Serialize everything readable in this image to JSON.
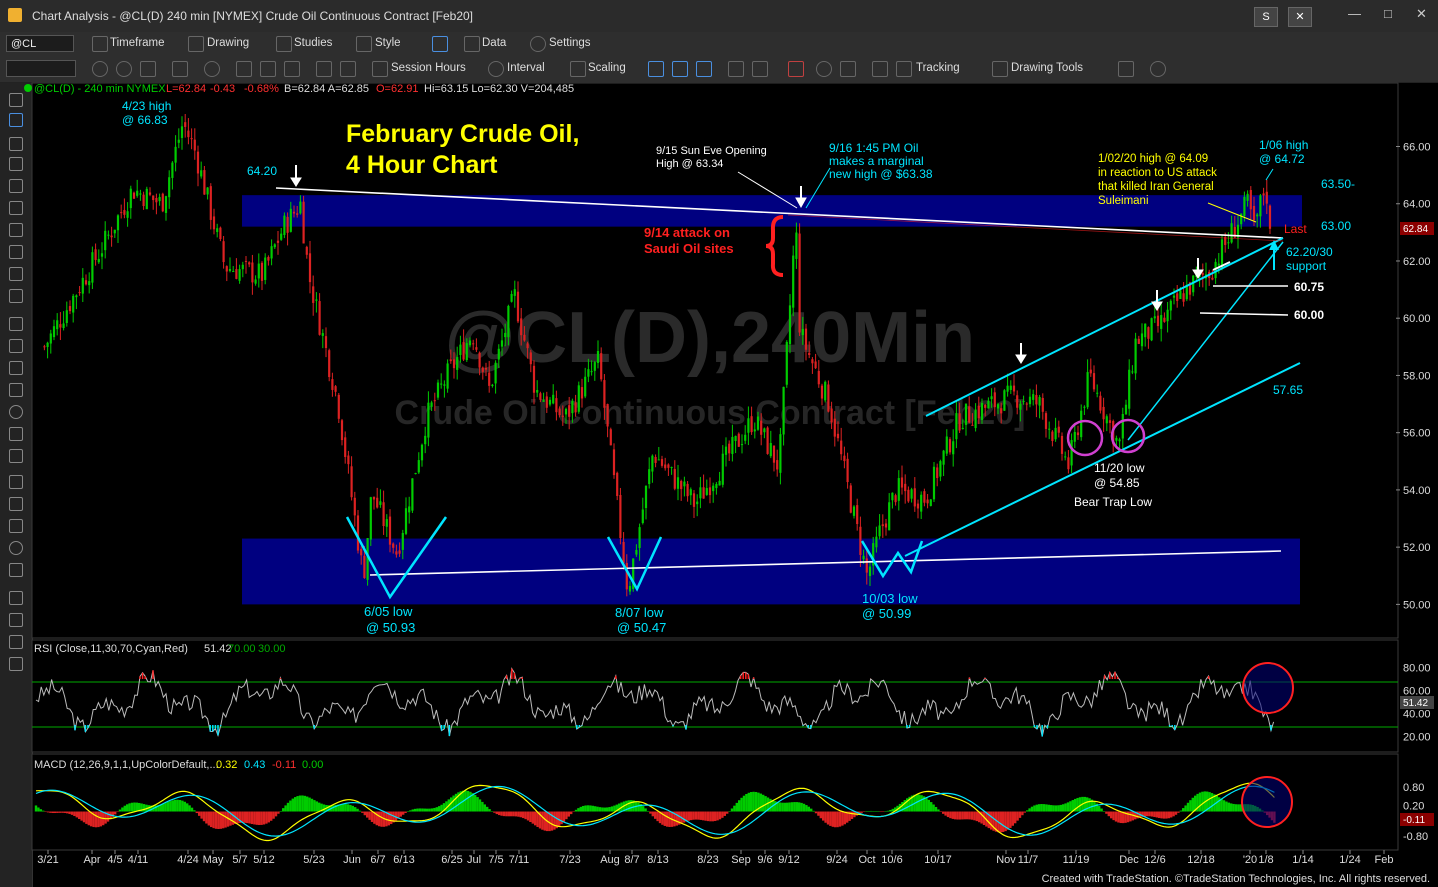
{
  "window": {
    "title": "Chart Analysis - @CL(D) 240 min [NYMEX] Crude Oil Continuous Contract [Feb20]",
    "btn_s": "S",
    "btn_tools": "✕"
  },
  "toolbar1": {
    "symbol": "@CL",
    "items": [
      "Timeframe",
      "Drawing",
      "Studies",
      "Style",
      "Data",
      "Settings"
    ]
  },
  "toolbar2": {
    "items": [
      "Session Hours",
      "Interval",
      "Scaling",
      "Tracking",
      "Drawing Tools"
    ]
  },
  "price_header": {
    "symbol": "@CL(D) - 240 min  NYMEX",
    "last": "L=62.84",
    "change": "-0.43",
    "pct": "-0.68%",
    "rest": "B=62.84  A=62.85",
    "open": "O=62.91",
    "tail": "Hi=63.15  Lo=62.30  V=204,485"
  },
  "watermark": {
    "big": "@CL(D),240Min",
    "sub": "Crude Oil Continuous Contract [Feb20]"
  },
  "colors": {
    "zone": "#000080",
    "up": "#00cc00",
    "down": "#dd2222",
    "cyan": "#00e5ff",
    "yellow": "#ffff00",
    "red_text": "#ff2020",
    "magenta": "#d040d0"
  },
  "annotations": {
    "title1": "February Crude Oil,",
    "title2": "4 Hour Chart",
    "high_423_a": "4/23 high",
    "high_423_b": "@ 66.83",
    "l6420": "64.20",
    "sunEve_a": "9/15 Sun Eve Opening",
    "sunEve_b": "High @ 63.34",
    "oil916_a": "9/16 1:45 PM Oil",
    "oil916_b": "makes a marginal",
    "oil916_c": "new high @ $63.38",
    "attack_a": "9/14 attack on",
    "attack_b": "Saudi Oil sites",
    "h0102_a": "1/02/20 high @ 64.09",
    "h0102_b": "in reaction to US attack",
    "h0102_c": "that killed Iran General",
    "h0102_d": "Suleimani",
    "h0106_a": "1/06 high",
    "h0106_b": "@ 64.72",
    "r6350": "63.50-",
    "r6300": "63.00",
    "last": "Last",
    "sup_a": "62.20/30",
    "sup_b": "support",
    "l6075": "60.75",
    "l6000": "60.00",
    "l5765": "57.65",
    "low1120_a": "11/20 low",
    "low1120_b": "@ 54.85",
    "beartrap": "Bear Trap Low",
    "low605_a": "6/05 low",
    "low605_b": "@ 50.93",
    "low807_a": "8/07 low",
    "low807_b": "@ 50.47",
    "low1003_a": "10/03 low",
    "low1003_b": "@ 50.99"
  },
  "rsi_header": {
    "label": "RSI (Close,11,30,70,Cyan,Red)",
    "value": "51.42",
    "ob": "70.00",
    "os": "30.00"
  },
  "macd_header": {
    "label": "MACD (12,26,9,1,1,UpColorDefault,...",
    "v1": "0.32",
    "v2": "0.43",
    "v3": "-0.11",
    "v4": "0.00"
  },
  "current_price_label": "62.84",
  "rsi_value_label": "51.42",
  "macd_value_label": "-0.11",
  "footer": "Created with TradeStation. ©TradeStation Technologies, Inc. All rights reserved.",
  "chart_data": [
    {
      "type": "candlestick",
      "title": "",
      "y_axis_ticks": [
        66,
        64,
        62,
        60,
        58,
        56,
        54,
        52,
        50
      ],
      "ylim": [
        49.0,
        67.8
      ],
      "x_tick_labels": [
        "3/21",
        "Apr",
        "4/5",
        "4/11",
        "4/24",
        "May",
        "5/7",
        "5/12",
        "5/23",
        "Jun",
        "6/7",
        "6/13",
        "6/25",
        "Jul",
        "7/5",
        "7/11",
        "7/23",
        "Aug",
        "8/7",
        "8/13",
        "8/23",
        "Sep",
        "9/6",
        "9/12",
        "9/24",
        "Oct",
        "10/6",
        "10/17",
        "Nov",
        "11/7",
        "11/19",
        "Dec",
        "12/6",
        "12/18",
        "'20",
        "1/8",
        "1/14",
        "1/24",
        "Feb"
      ],
      "price_path": [
        {
          "date": "2019-03-21",
          "price": 59.0
        },
        {
          "date": "2019-04-05",
          "price": 62.8
        },
        {
          "date": "2019-04-11",
          "price": 64.5
        },
        {
          "date": "2019-04-18",
          "price": 64.0
        },
        {
          "date": "2019-04-23",
          "price": 66.83
        },
        {
          "date": "2019-04-26",
          "price": 65.8
        },
        {
          "date": "2019-05-03",
          "price": 61.8
        },
        {
          "date": "2019-05-12",
          "price": 61.5
        },
        {
          "date": "2019-05-17",
          "price": 63.2
        },
        {
          "date": "2019-05-21",
          "price": 64.0
        },
        {
          "date": "2019-05-23",
          "price": 61.5
        },
        {
          "date": "2019-05-30",
          "price": 57.0
        },
        {
          "date": "2019-06-05",
          "price": 50.93
        },
        {
          "date": "2019-06-07",
          "price": 53.9
        },
        {
          "date": "2019-06-13",
          "price": 51.8
        },
        {
          "date": "2019-06-20",
          "price": 56.5
        },
        {
          "date": "2019-06-25",
          "price": 58.0
        },
        {
          "date": "2019-07-01",
          "price": 59.5
        },
        {
          "date": "2019-07-05",
          "price": 57.5
        },
        {
          "date": "2019-07-11",
          "price": 60.8
        },
        {
          "date": "2019-07-16",
          "price": 57.5
        },
        {
          "date": "2019-07-23",
          "price": 56.5
        },
        {
          "date": "2019-07-31",
          "price": 58.5
        },
        {
          "date": "2019-08-07",
          "price": 50.47
        },
        {
          "date": "2019-08-13",
          "price": 55.3
        },
        {
          "date": "2019-08-23",
          "price": 53.5
        },
        {
          "date": "2019-08-30",
          "price": 55.0
        },
        {
          "date": "2019-09-06",
          "price": 56.5
        },
        {
          "date": "2019-09-12",
          "price": 54.8
        },
        {
          "date": "2019-09-16",
          "price": 63.38
        },
        {
          "date": "2019-09-17",
          "price": 59.5
        },
        {
          "date": "2019-09-24",
          "price": 57.0
        },
        {
          "date": "2019-10-03",
          "price": 50.99
        },
        {
          "date": "2019-10-06",
          "price": 52.5
        },
        {
          "date": "2019-10-10",
          "price": 54.0
        },
        {
          "date": "2019-10-17",
          "price": 53.7
        },
        {
          "date": "2019-10-25",
          "price": 56.5
        },
        {
          "date": "2019-11-07",
          "price": 57.3
        },
        {
          "date": "2019-11-13",
          "price": 57.0
        },
        {
          "date": "2019-11-20",
          "price": 54.85
        },
        {
          "date": "2019-11-25",
          "price": 58.0
        },
        {
          "date": "2019-12-02",
          "price": 55.5
        },
        {
          "date": "2019-12-06",
          "price": 59.2
        },
        {
          "date": "2019-12-12",
          "price": 59.8
        },
        {
          "date": "2019-12-18",
          "price": 61.0
        },
        {
          "date": "2019-12-24",
          "price": 61.7
        },
        {
          "date": "2020-01-02",
          "price": 64.09
        },
        {
          "date": "2020-01-03",
          "price": 63.0
        },
        {
          "date": "2020-01-06",
          "price": 64.72
        },
        {
          "date": "2020-01-07",
          "price": 62.84
        }
      ],
      "price_zones": [
        [
          63.2,
          64.3
        ],
        [
          50.0,
          52.3
        ]
      ],
      "horizontal_levels": [
        60.75,
        60.0
      ]
    },
    {
      "type": "line",
      "title": "RSI (Close,11,30,70,Cyan,Red)",
      "y_axis_ticks": [
        80,
        60,
        40,
        20
      ],
      "ylim": [
        10,
        90
      ],
      "series": [
        {
          "name": "RSI",
          "last": 51.42
        }
      ],
      "reference_lines": [
        70,
        30
      ]
    },
    {
      "type": "line",
      "title": "MACD (12,26,9,1,1,UpColorDefault,...",
      "y_axis_ticks": [
        0.8,
        0.2,
        -0.2,
        -0.8
      ],
      "ylim": [
        -1.2,
        1.3
      ],
      "series": [
        {
          "name": "MACD",
          "last": 0.32
        },
        {
          "name": "Signal",
          "last": 0.43
        },
        {
          "name": "Histogram",
          "last": -0.11
        }
      ]
    }
  ]
}
